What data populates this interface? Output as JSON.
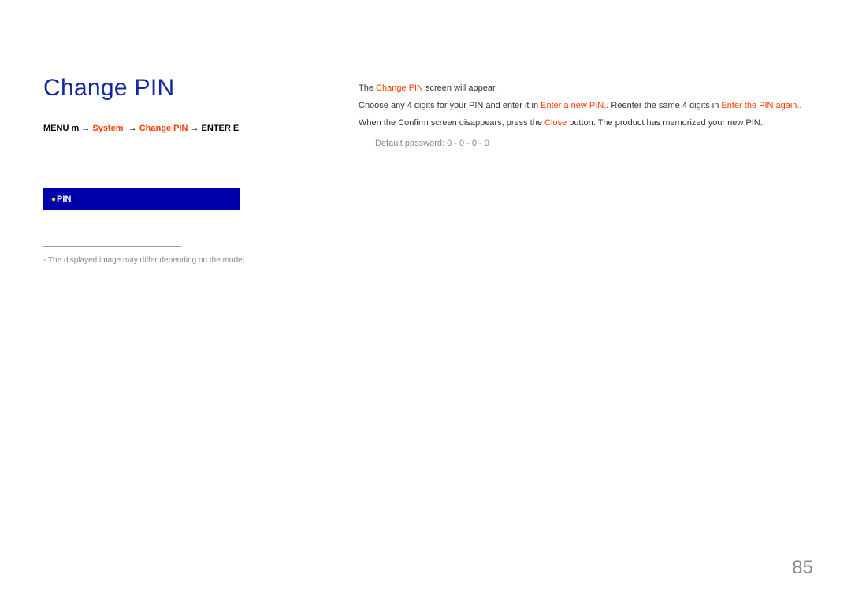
{
  "title": "Change PIN",
  "breadcrumb": {
    "menu": "MENU",
    "menukey": "m",
    "arrow": "→",
    "system": "System",
    "changepin": "Change PIN",
    "enter": "ENTER",
    "enterkey": "E"
  },
  "menu_item": {
    "label": "PIN"
  },
  "footnote": "The displayed image may differ depending on the model.",
  "body": {
    "line1_pre": "The ",
    "line1_hl": "Change PIN",
    "line1_post": " screen will appear.",
    "line2_pre": "Choose any 4 digits for your PIN and enter it in ",
    "line2_hl1": "Enter a new PIN.",
    "line2_mid": ". Reenter the same 4 digits in ",
    "line2_hl2": "Enter the PIN again.",
    "line2_post": ".",
    "line3_pre": "When the Confirm screen disappears, press the ",
    "line3_hl": "Close",
    "line3_post": " button. The product has memorized your new PIN."
  },
  "default_password": "Default password: 0 - 0 - 0 - 0",
  "page_number": "85"
}
